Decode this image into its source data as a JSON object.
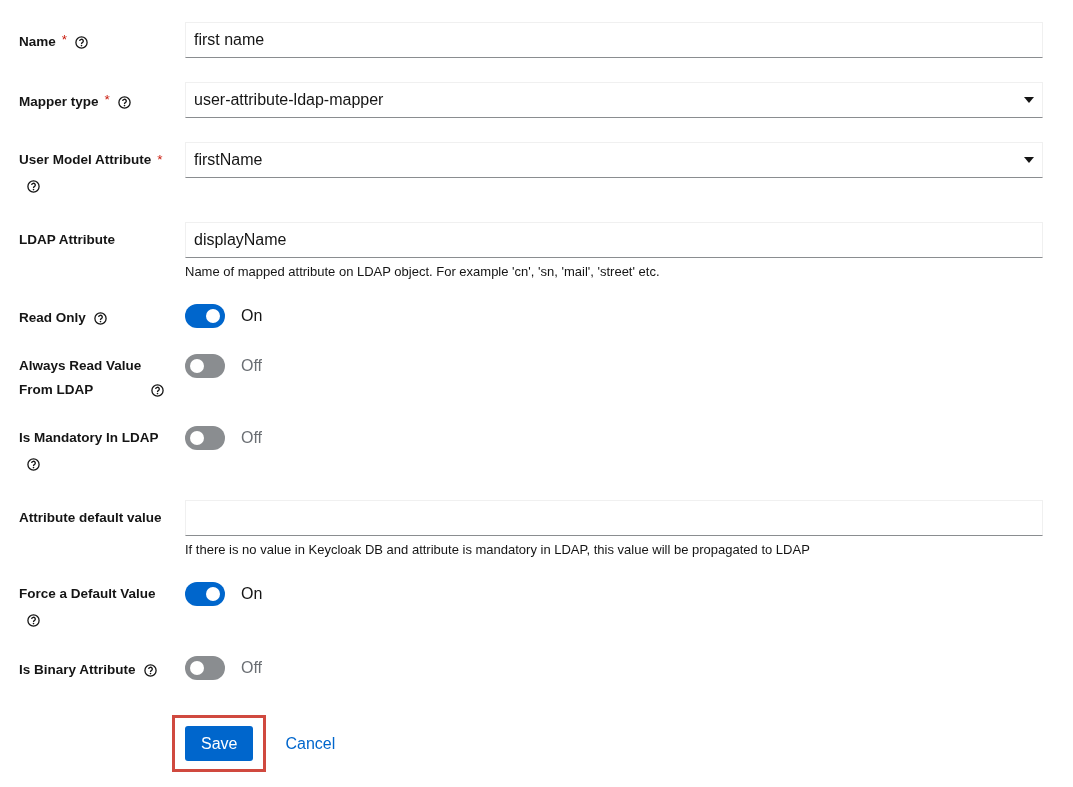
{
  "fields": [
    {
      "kind": "text",
      "label": "Name",
      "required_mark": "*",
      "help": true,
      "value": "first name"
    },
    {
      "kind": "select",
      "label": "Mapper type",
      "required_mark": "*",
      "help": true,
      "value": "user-attribute-ldap-mapper"
    },
    {
      "kind": "select",
      "label": "User Model Attribute",
      "required_mark": "*",
      "help": true,
      "value": "firstName"
    },
    {
      "kind": "text",
      "label": "LDAP Attribute",
      "help": false,
      "value": "displayName",
      "helper_text": "Name of mapped attribute on LDAP object. For example 'cn', 'sn, 'mail', 'street' etc."
    },
    {
      "kind": "switch",
      "label": "Read Only",
      "help": true,
      "on": true,
      "state_text": "On"
    },
    {
      "kind": "switch",
      "label": "Always Read Value From LDAP",
      "help": true,
      "on": false,
      "state_text": "Off"
    },
    {
      "kind": "switch",
      "label": "Is Mandatory In LDAP",
      "help": true,
      "on": false,
      "state_text": "Off"
    },
    {
      "kind": "text",
      "label": "Attribute default value",
      "help": false,
      "helper_text": "If there is no value in Keycloak DB and attribute is mandatory in LDAP, this value will be propagated to LDAP"
    },
    {
      "kind": "switch",
      "label": "Force a Default Value",
      "help": true,
      "on": true,
      "state_text": "On"
    },
    {
      "kind": "switch",
      "label": "Is Binary Attribute",
      "help": true,
      "on": false,
      "state_text": "Off"
    }
  ],
  "actions": [
    {
      "kind": "primary",
      "label": "Save",
      "highlighted": true
    },
    {
      "kind": "link",
      "label": "Cancel",
      "highlighted": false
    }
  ]
}
